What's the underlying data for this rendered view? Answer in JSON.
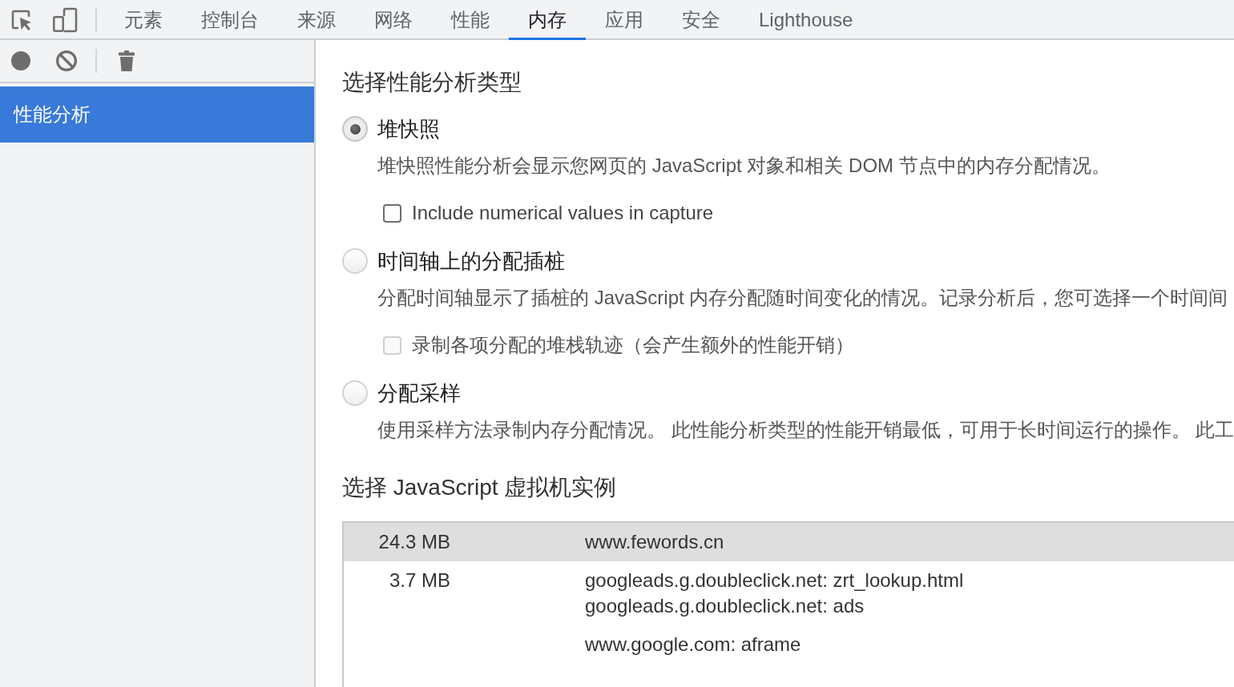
{
  "toolbar": {
    "tabs": [
      {
        "label": "元素",
        "selected": false
      },
      {
        "label": "控制台",
        "selected": false
      },
      {
        "label": "来源",
        "selected": false
      },
      {
        "label": "网络",
        "selected": false
      },
      {
        "label": "性能",
        "selected": false
      },
      {
        "label": "内存",
        "selected": true
      },
      {
        "label": "应用",
        "selected": false
      },
      {
        "label": "安全",
        "selected": false
      },
      {
        "label": "Lighthouse",
        "selected": false
      }
    ]
  },
  "sidebar": {
    "items": [
      {
        "label": "性能分析",
        "selected": true
      }
    ]
  },
  "profile_types": {
    "title": "选择性能分析类型",
    "options": [
      {
        "label": "堆快照",
        "selected": true,
        "description": "堆快照性能分析会显示您网页的 JavaScript 对象和相关 DOM 节点中的内存分配情况。",
        "checkbox": {
          "label": "Include numerical values in capture",
          "checked": false,
          "disabled": false
        }
      },
      {
        "label": "时间轴上的分配插桩",
        "selected": false,
        "description": "分配时间轴显示了插桩的 JavaScript 内存分配随时间变化的情况。记录分析后，您可选择一个时间间",
        "checkbox": {
          "label": "录制各项分配的堆栈轨迹（会产生额外的性能开销）",
          "checked": false,
          "disabled": true
        }
      },
      {
        "label": "分配采样",
        "selected": false,
        "description": "使用采样方法录制内存分配情况。 此性能分析类型的性能开销最低，可用于长时间运行的操作。 此工"
      }
    ]
  },
  "vm_instances": {
    "title": "选择 JavaScript 虚拟机实例",
    "rows": [
      {
        "size": "24.3 MB",
        "urls": [
          "www.fewords.cn"
        ],
        "selected": true
      },
      {
        "size": "3.7 MB",
        "urls": [
          "googleads.g.doubleclick.net: zrt_lookup.html",
          "googleads.g.doubleclick.net: ads"
        ],
        "selected": false
      },
      {
        "urls": [
          "www.google.com: aframe"
        ],
        "selected": false
      }
    ]
  }
}
